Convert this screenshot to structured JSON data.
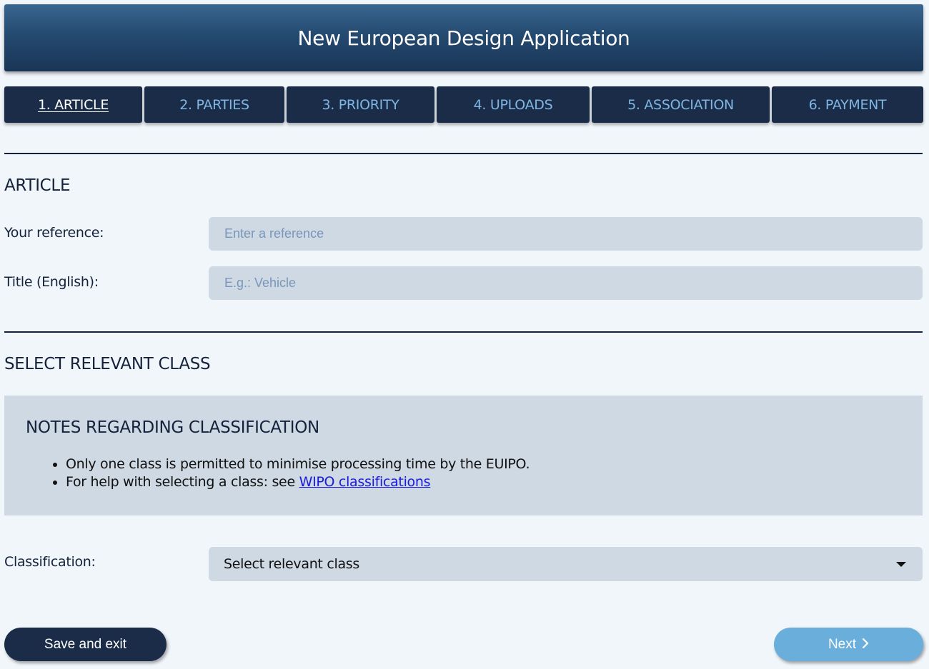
{
  "header": {
    "title": "New European Design Application"
  },
  "tabs": [
    {
      "label": "1. ARTICLE",
      "active": true
    },
    {
      "label": "2. PARTIES",
      "active": false
    },
    {
      "label": "3. PRIORITY",
      "active": false
    },
    {
      "label": "4. UPLOADS",
      "active": false
    },
    {
      "label": "5. ASSOCIATION",
      "active": false
    },
    {
      "label": "6. PAYMENT",
      "active": false
    }
  ],
  "article": {
    "title": "ARTICLE",
    "reference_label": "Your reference:",
    "reference_placeholder": "Enter a reference",
    "reference_value": "",
    "title_label": "Title (English):",
    "title_placeholder": "E.g.: Vehicle",
    "title_value": ""
  },
  "class_section": {
    "title": "SELECT RELEVANT CLASS",
    "notes_title": "NOTES REGARDING CLASSIFICATION",
    "note_1": "Only one class is permitted to minimise processing time by the EUIPO.",
    "note_2_prefix": "For help with selecting a class: see ",
    "note_2_link": "WIPO classifications",
    "classification_label": "Classification:",
    "classification_selected": "Select relevant class"
  },
  "actions": {
    "save_label": "Save and exit",
    "next_label": "Next"
  },
  "colors": {
    "header_top": "#3a6690",
    "header_bottom": "#1a3556",
    "tab_bg": "#1a2c48",
    "tab_text": "#7fb6e3",
    "input_bg": "#ced9e4",
    "page_bg": "#f1f6fb",
    "next_button": "#6aaedb",
    "link": "#1a1adf"
  }
}
